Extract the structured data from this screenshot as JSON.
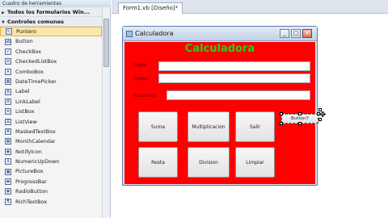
{
  "toolbox": {
    "header": "Cuadro de herramientas",
    "section_all": "Todos los formularios Win...",
    "section_common": "Controles comunes",
    "items": [
      {
        "label": "Puntero",
        "icon": "pointer-icon",
        "selected": true
      },
      {
        "label": "Button",
        "icon": "button-icon"
      },
      {
        "label": "CheckBox",
        "icon": "checkbox-icon"
      },
      {
        "label": "CheckedListBox",
        "icon": "checkedlistbox-icon"
      },
      {
        "label": "ComboBox",
        "icon": "combobox-icon"
      },
      {
        "label": "DateTimePicker",
        "icon": "datetimepicker-icon"
      },
      {
        "label": "Label",
        "icon": "label-icon"
      },
      {
        "label": "LinkLabel",
        "icon": "linklabel-icon"
      },
      {
        "label": "ListBox",
        "icon": "listbox-icon"
      },
      {
        "label": "ListView",
        "icon": "listview-icon"
      },
      {
        "label": "MaskedTextBox",
        "icon": "maskedtextbox-icon"
      },
      {
        "label": "MonthCalendar",
        "icon": "monthcalendar-icon"
      },
      {
        "label": "NotifyIcon",
        "icon": "notifyicon-icon"
      },
      {
        "label": "NumericUpDown",
        "icon": "numericupdown-icon"
      },
      {
        "label": "PictureBox",
        "icon": "picturebox-icon"
      },
      {
        "label": "ProgressBar",
        "icon": "progressbar-icon"
      },
      {
        "label": "RadioButton",
        "icon": "radiobutton-icon"
      },
      {
        "label": "RichTextBox",
        "icon": "richtextbox-icon"
      }
    ]
  },
  "tabs": {
    "active": "Form1.vb [Diseño]*"
  },
  "form": {
    "title": "Calculadora",
    "heading": "Calculadora",
    "label1": "Digite",
    "label2": "Digite2",
    "label3": "Resultado",
    "buttons": {
      "suma": "Suma",
      "multiplicacion": "Multiplicacion",
      "salir": "Salir",
      "resta": "Resta",
      "division": "Division",
      "limpiar": "Limpiar",
      "button7": "Button7"
    }
  },
  "colors": {
    "form_back": "#ff0000",
    "heading": "#39c41e",
    "selection": "#fbe6a8"
  }
}
